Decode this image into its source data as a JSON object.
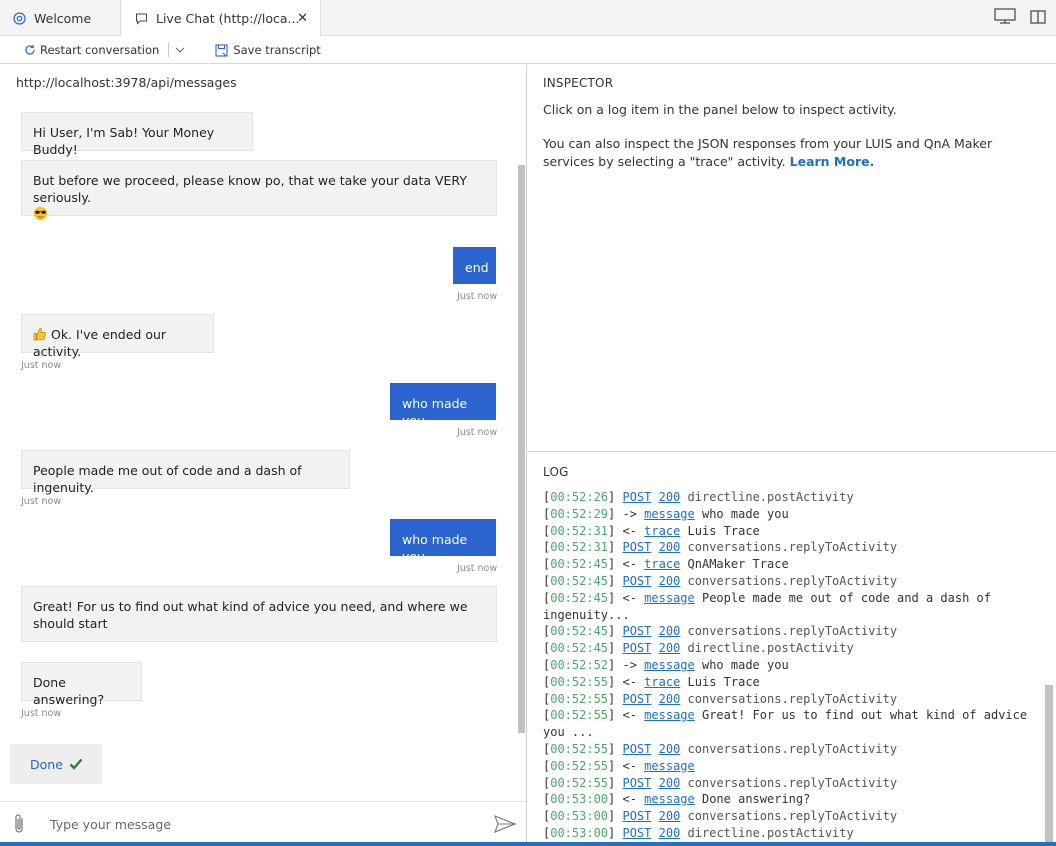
{
  "tabs": [
    {
      "label": "Welcome",
      "icon": "globe-icon"
    },
    {
      "label": "Live Chat (http://loca...",
      "icon": "chat-icon"
    }
  ],
  "toolbar": {
    "restart_label": "Restart conversation",
    "save_label": "Save transcript"
  },
  "chat": {
    "endpoint": "http://localhost:3978/api/messages",
    "messages": [
      {
        "from": "bot",
        "text": "Hi User, I'm Sab! Your Money Buddy!"
      },
      {
        "from": "bot",
        "text": "But before we proceed, please know po, that we take your data VERY seriously.",
        "emoji": "sunglasses-emoji"
      },
      {
        "from": "user",
        "text": "end",
        "time": "Just now"
      },
      {
        "from": "bot",
        "text": "Ok. I've ended our activity.",
        "emoji": "thumbs-up-emoji",
        "time": "Just now"
      },
      {
        "from": "user",
        "text": "who made you",
        "time": "Just now"
      },
      {
        "from": "bot",
        "text": "People made me out of code and a dash of ingenuity.",
        "time": "Just now"
      },
      {
        "from": "user",
        "text": "who made you",
        "time": "Just now"
      },
      {
        "from": "bot",
        "text": "Great! For us to find out what kind of advice you need, and where we should start"
      },
      {
        "from": "bot",
        "text": "Done answering?",
        "time": "Just now"
      }
    ],
    "suggested_action": "Done",
    "input_placeholder": "Type your message"
  },
  "inspector": {
    "title": "INSPECTOR",
    "line1": "Click on a log item in the panel below to inspect activity.",
    "line2": "You can also inspect the JSON responses from your LUIS and QnA Maker services by selecting a \"trace\" activity.",
    "learn_more": "Learn More."
  },
  "log": {
    "title": "LOG",
    "entries": [
      {
        "time": "00:52:26",
        "kind": "POST",
        "status": "200",
        "text": "directline.postActivity"
      },
      {
        "time": "00:52:29",
        "dir": "->",
        "link": "message",
        "text": "who made you"
      },
      {
        "time": "00:52:31",
        "dir": "<-",
        "link": "trace",
        "text": "Luis Trace"
      },
      {
        "time": "00:52:31",
        "kind": "POST",
        "status": "200",
        "text": "conversations.replyToActivity"
      },
      {
        "time": "00:52:45",
        "dir": "<-",
        "link": "trace",
        "text": "QnAMaker Trace"
      },
      {
        "time": "00:52:45",
        "kind": "POST",
        "status": "200",
        "text": "conversations.replyToActivity"
      },
      {
        "time": "00:52:45",
        "dir": "<-",
        "link": "message",
        "text": "People made me out of code and a dash of ingenuity..."
      },
      {
        "time": "00:52:45",
        "kind": "POST",
        "status": "200",
        "text": "conversations.replyToActivity"
      },
      {
        "time": "00:52:45",
        "kind": "POST",
        "status": "200",
        "text": "directline.postActivity"
      },
      {
        "time": "00:52:52",
        "dir": "->",
        "link": "message",
        "text": "who made you"
      },
      {
        "time": "00:52:55",
        "dir": "<-",
        "link": "trace",
        "text": "Luis Trace"
      },
      {
        "time": "00:52:55",
        "kind": "POST",
        "status": "200",
        "text": "conversations.replyToActivity"
      },
      {
        "time": "00:52:55",
        "dir": "<-",
        "link": "message",
        "text": "Great! For us to find out what kind of advice you ..."
      },
      {
        "time": "00:52:55",
        "kind": "POST",
        "status": "200",
        "text": "conversations.replyToActivity"
      },
      {
        "time": "00:52:55",
        "dir": "<-",
        "link": "message",
        "text": ""
      },
      {
        "time": "00:52:55",
        "kind": "POST",
        "status": "200",
        "text": "conversations.replyToActivity"
      },
      {
        "time": "00:53:00",
        "dir": "<-",
        "link": "message",
        "text": "Done answering?"
      },
      {
        "time": "00:53:00",
        "kind": "POST",
        "status": "200",
        "text": "conversations.replyToActivity"
      },
      {
        "time": "00:53:00",
        "kind": "POST",
        "status": "200",
        "text": "directline.postActivity"
      }
    ]
  },
  "colors": {
    "user_bubble": "#2b64cf",
    "link": "#1f6fc5",
    "timestamp_green": "#4aa86a",
    "status_bar": "#1e72c6"
  }
}
